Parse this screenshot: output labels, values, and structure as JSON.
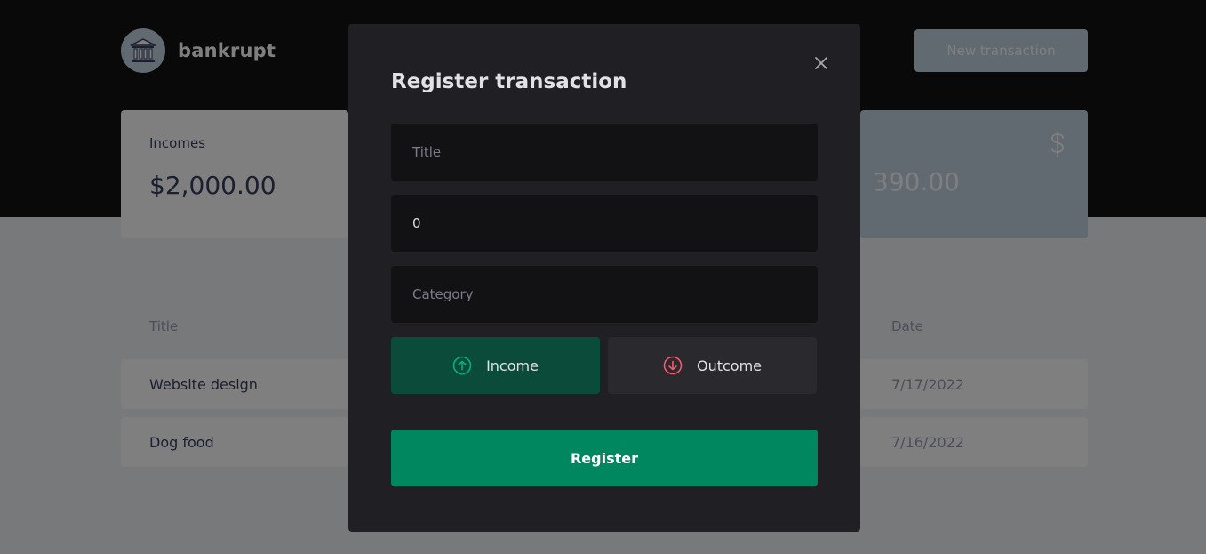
{
  "brand": {
    "name": "bankrupt",
    "logo_icon": "bank-building-icon"
  },
  "header": {
    "new_transaction_label": "New transaction"
  },
  "summary": {
    "incomes": {
      "label": "Incomes",
      "value": "$2,000.00"
    },
    "total": {
      "value_visible": "390.00",
      "icon": "dollar-icon"
    }
  },
  "table": {
    "headers": {
      "title": "Title",
      "date": "Date"
    },
    "rows": [
      {
        "title": "Website design",
        "date": "7/17/2022"
      },
      {
        "title": "Dog food",
        "date": "7/16/2022"
      }
    ]
  },
  "modal": {
    "title": "Register transaction",
    "close_icon": "close-icon",
    "fields": {
      "title_placeholder": "Title",
      "amount_value": "0",
      "category_placeholder": "Category"
    },
    "type": {
      "income_label": "Income",
      "outcome_label": "Outcome",
      "selected": "income"
    },
    "submit_label": "Register"
  },
  "colors": {
    "header_bg": "#121214",
    "accent_blue": "#c3d3e2",
    "modal_bg": "#202024",
    "input_bg": "#121214",
    "green": "#00875f",
    "red": "#f75a68"
  }
}
